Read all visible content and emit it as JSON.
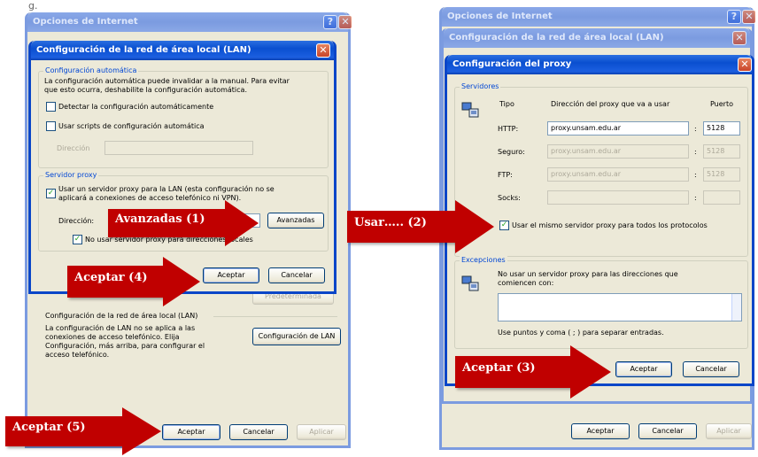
{
  "fragment": "g.",
  "left": {
    "outer_title": "Opciones de Internet",
    "lan_title": "Configuración de la red de área local (LAN)",
    "auto_group": "Configuración automática",
    "auto_desc_1": "La configuración automática puede invalidar a la manual. Para evitar",
    "auto_desc_2": "que esto ocurra, deshabilite la configuración automática.",
    "detect_label": "Detectar la configuración automáticamente",
    "scripts_label": "Usar scripts de configuración automática",
    "direccion_label_auto": "Dirección",
    "proxy_group": "Servidor proxy",
    "use_proxy_1": "Usar un servidor proxy para la LAN (esta configuración no se",
    "use_proxy_2": "aplicará a conexiones de acceso telefónico ni VPN).",
    "direccion_label": "Dirección:",
    "avanzadas": "Avanzadas",
    "no_proxy_local": "No usar servidor proxy para direcciones locales",
    "aceptar": "Aceptar",
    "cancelar": "Cancelar",
    "predeterminada": "Predeterminada",
    "lan_section": "Configuración de la red de área local (LAN)",
    "lan_desc_1": "La configuración de LAN no se aplica a las",
    "lan_desc_2": "conexiones de acceso telefónico. Elija",
    "lan_desc_3": "Configuración, más arriba, para configurar el",
    "lan_desc_4": "acceso telefónico.",
    "config_lan_btn": "Configuración de LAN",
    "outer_aceptar": "Aceptar",
    "outer_cancelar": "Cancelar",
    "outer_aplicar": "Aplicar"
  },
  "right": {
    "outer_title": "Opciones de Internet",
    "lan_title": "Configuración de la red de área local (LAN)",
    "proxy_title": "Configuración del proxy",
    "servers_group": "Servidores",
    "col_tipo": "Tipo",
    "col_dir": "Dirección del proxy que va a usar",
    "col_puerto": "Puerto",
    "rows": [
      {
        "label": "HTTP:",
        "value": "proxy.unsam.edu.ar",
        "port": "5128",
        "enabled": true
      },
      {
        "label": "Seguro:",
        "value": "proxy.unsam.edu.ar",
        "port": "5128",
        "enabled": false
      },
      {
        "label": "FTP:",
        "value": "proxy.unsam.edu.ar",
        "port": "5128",
        "enabled": false
      },
      {
        "label": "Socks:",
        "value": "",
        "port": "",
        "enabled": false
      }
    ],
    "same_proxy": "Usar el mismo servidor proxy para todos los protocolos",
    "exceptions_group": "Excepciones",
    "exc_desc_1": "No usar un servidor proxy para las direcciones que",
    "exc_desc_2": "comiencen con:",
    "exc_hint": "Use puntos y coma ( ; ) para separar entradas.",
    "aceptar": "Aceptar",
    "cancelar": "Cancelar",
    "outer_aceptar": "Aceptar",
    "outer_cancelar": "Cancelar",
    "outer_aplicar": "Aplicar"
  },
  "annotations": {
    "a1": "Avanzadas (1)",
    "a2": "Usar….. (2)",
    "a3": "Aceptar  (3)",
    "a4": "Aceptar  (4)",
    "a5": "Aceptar  (5)"
  },
  "colors": {
    "arrow": "#c00000",
    "xp_blue": "#0a4fd0",
    "dialog_bg": "#ece9d8"
  }
}
